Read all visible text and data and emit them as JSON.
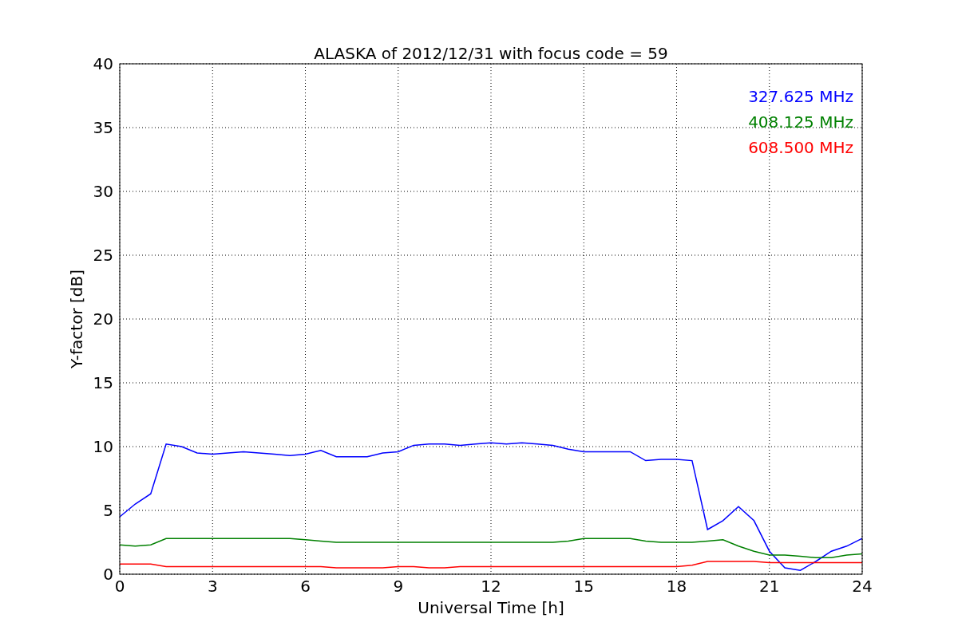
{
  "figure": {
    "chart_data": {
      "type": "line",
      "title": "ALASKA of 2012/12/31 with focus code = 59",
      "xlabel": "Universal Time [h]",
      "ylabel": "Y-factor [dB]",
      "x": [
        0,
        0.5,
        1,
        1.5,
        2,
        2.5,
        3,
        3.5,
        4,
        4.5,
        5,
        5.5,
        6,
        6.5,
        7,
        7.5,
        8,
        8.5,
        9,
        9.5,
        10,
        10.5,
        11,
        11.5,
        12,
        12.5,
        13,
        13.5,
        14,
        14.5,
        15,
        15.5,
        16,
        16.5,
        17,
        17.5,
        18,
        18.5,
        19,
        19.5,
        20,
        20.5,
        21,
        21.5,
        22,
        22.5,
        23,
        23.5,
        24
      ],
      "series": [
        {
          "name": "327.625 MHz",
          "color": "#0000ff",
          "values": [
            4.5,
            5.5,
            6.3,
            10.2,
            10,
            9.5,
            9.4,
            9.5,
            9.6,
            9.5,
            9.4,
            9.3,
            9.4,
            9.7,
            9.2,
            9.2,
            9.2,
            9.5,
            9.6,
            10.1,
            10.2,
            10.2,
            10.1,
            10.2,
            10.3,
            10.2,
            10.3,
            10.2,
            10.1,
            9.8,
            9.6,
            9.6,
            9.6,
            9.6,
            8.9,
            9,
            9,
            8.9,
            3.5,
            4.2,
            5.3,
            4.2,
            1.8,
            0.5,
            0.3,
            1,
            1.8,
            2.2,
            2.8
          ]
        },
        {
          "name": "408.125 MHz",
          "color": "#008000",
          "values": [
            2.3,
            2.2,
            2.3,
            2.8,
            2.8,
            2.8,
            2.8,
            2.8,
            2.8,
            2.8,
            2.8,
            2.8,
            2.7,
            2.6,
            2.5,
            2.5,
            2.5,
            2.5,
            2.5,
            2.5,
            2.5,
            2.5,
            2.5,
            2.5,
            2.5,
            2.5,
            2.5,
            2.5,
            2.5,
            2.6,
            2.8,
            2.8,
            2.8,
            2.8,
            2.6,
            2.5,
            2.5,
            2.5,
            2.6,
            2.7,
            2.2,
            1.8,
            1.5,
            1.5,
            1.4,
            1.3,
            1.3,
            1.5,
            1.6
          ]
        },
        {
          "name": "608.500 MHz",
          "color": "#ff0000",
          "values": [
            0.8,
            0.8,
            0.8,
            0.6,
            0.6,
            0.6,
            0.6,
            0.6,
            0.6,
            0.6,
            0.6,
            0.6,
            0.6,
            0.6,
            0.5,
            0.5,
            0.5,
            0.5,
            0.6,
            0.6,
            0.5,
            0.5,
            0.6,
            0.6,
            0.6,
            0.6,
            0.6,
            0.6,
            0.6,
            0.6,
            0.6,
            0.6,
            0.6,
            0.6,
            0.6,
            0.6,
            0.6,
            0.7,
            1,
            1,
            1,
            1,
            0.9,
            0.9,
            0.9,
            0.9,
            0.9,
            0.9,
            0.9
          ]
        }
      ],
      "grid": true,
      "xlim": [
        0,
        24
      ],
      "ylim": [
        0,
        40
      ],
      "xticks": [
        0,
        3,
        6,
        9,
        12,
        15,
        18,
        21,
        24
      ],
      "yticks": [
        0,
        5,
        10,
        15,
        20,
        25,
        30,
        35,
        40
      ]
    }
  }
}
